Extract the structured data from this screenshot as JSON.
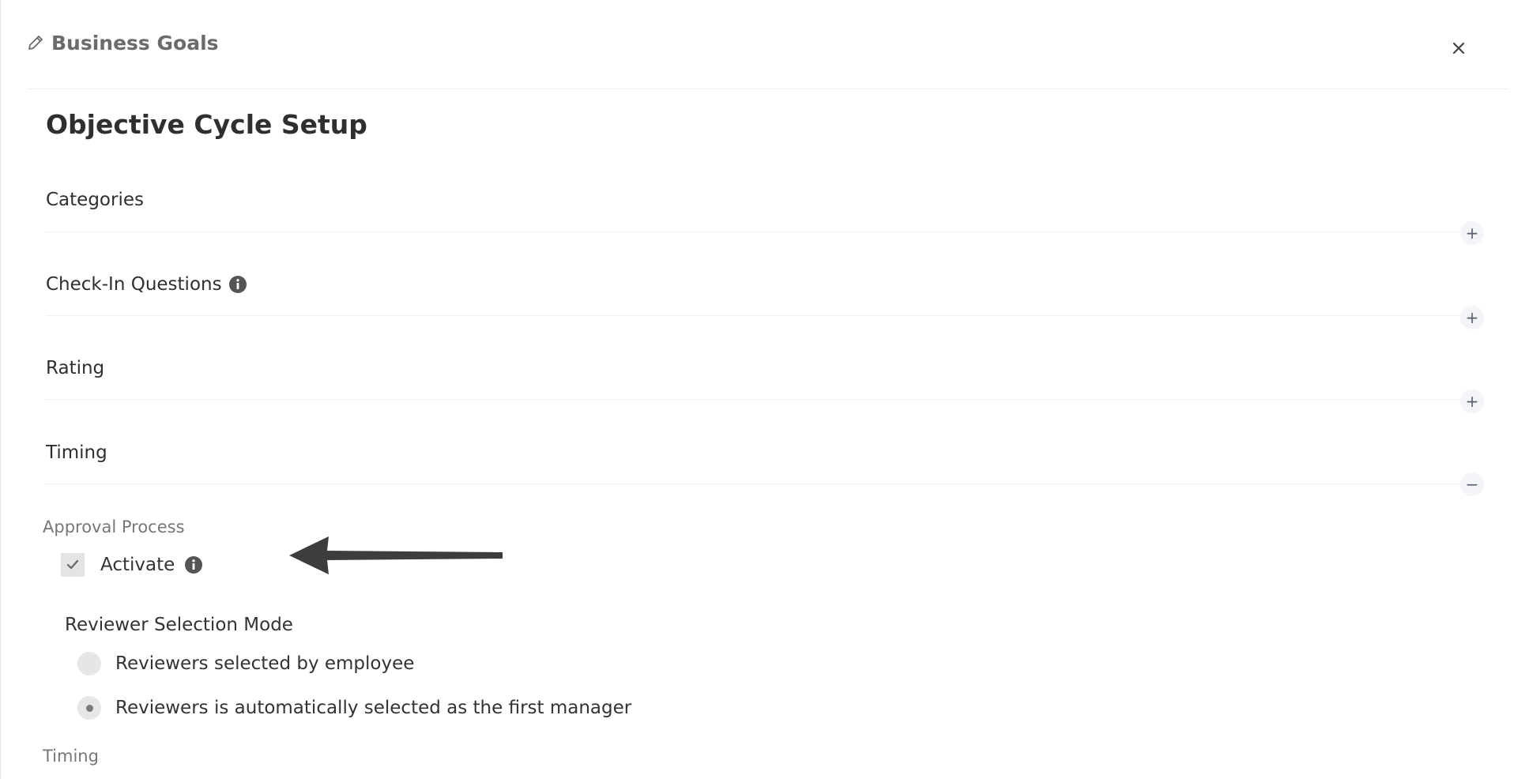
{
  "header": {
    "title": "Business Goals",
    "edit_icon": "pencil-icon",
    "close_icon": "close-icon"
  },
  "page": {
    "title": "Objective Cycle Setup"
  },
  "sections": [
    {
      "title": "Categories",
      "state": "collapsed",
      "toggle": "+"
    },
    {
      "title": "Check-In Questions",
      "state": "collapsed",
      "toggle": "+",
      "has_info": true
    },
    {
      "title": "Rating",
      "state": "collapsed",
      "toggle": "+"
    },
    {
      "title": "Timing",
      "state": "expanded",
      "toggle": "−"
    }
  ],
  "approval": {
    "label": "Approval Process",
    "activate_label": "Activate",
    "activate_checked": true
  },
  "reviewer_mode": {
    "title": "Reviewer Selection Mode",
    "options": [
      {
        "label": "Reviewers selected by employee",
        "selected": false
      },
      {
        "label": "Reviewers is automatically selected as the first manager",
        "selected": true
      }
    ]
  },
  "timing_sub": {
    "label": "Timing"
  },
  "colors": {
    "accent_toggle_bg": "#f4f5f9",
    "arrow": "#3d3d3d"
  }
}
